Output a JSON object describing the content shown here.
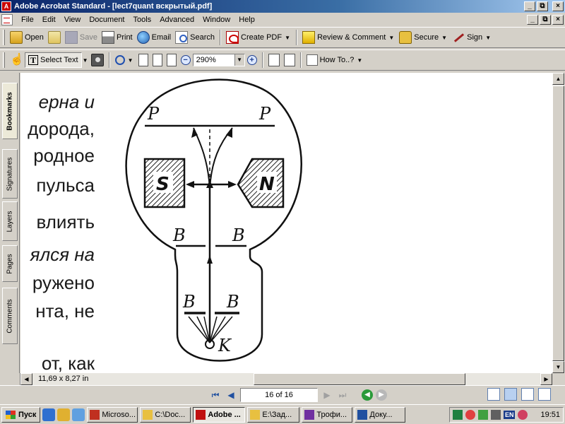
{
  "window": {
    "title": "Adobe Acrobat Standard - [lect7quant вскрытый.pdf]",
    "app_icon": "acrobat-icon",
    "buttons": [
      "_",
      "⧉",
      "×"
    ]
  },
  "menubar": {
    "items": [
      "File",
      "Edit",
      "View",
      "Document",
      "Tools",
      "Advanced",
      "Window",
      "Help"
    ],
    "doc_buttons": [
      "_",
      "⧉",
      "×"
    ]
  },
  "toolbar1": {
    "open": "Open",
    "save": "Save",
    "print": "Print",
    "email": "Email",
    "search": "Search",
    "create_pdf": "Create PDF",
    "review": "Review & Comment",
    "secure": "Secure",
    "sign": "Sign"
  },
  "toolbar2": {
    "hand_icon": "☝",
    "select_text": "Select Text",
    "zoom_value": "290%",
    "how_to": "How To..?"
  },
  "navtabs": [
    "Bookmarks",
    "Signatures",
    "Layers",
    "Pages",
    "Comments"
  ],
  "document": {
    "text_lines": [
      {
        "text": "ерна  и",
        "italic": true
      },
      {
        "text": "дорода,",
        "italic": false
      },
      {
        "text": "родное",
        "italic": false
      },
      {
        "text": "пульса",
        "italic": false
      },
      {
        "text": "влиять",
        "italic": false
      },
      {
        "text": "ялся на",
        "italic": true
      },
      {
        "text": "ружено",
        "italic": false
      },
      {
        "text": "нта,  не",
        "italic": false
      },
      {
        "text": "от,   как",
        "italic": false
      }
    ],
    "diagram_labels": {
      "p_left": "P",
      "p_right": "P",
      "s": "S",
      "n": "N",
      "b_mid_left": "B",
      "b_mid_right": "B",
      "b_low_left": "B",
      "b_low_right": "B",
      "k": "K"
    }
  },
  "status": {
    "page_size": "11,69 x 8,27 in",
    "page_field": "16 of 16"
  },
  "taskbar": {
    "start": "Пуск",
    "tasks": [
      {
        "label": "Microso...",
        "active": false,
        "color": "#c03020"
      },
      {
        "label": "C:\\Doc...",
        "active": false,
        "color": "#e8c040"
      },
      {
        "label": "Adobe ...",
        "active": true,
        "color": "#c01010"
      },
      {
        "label": "E:\\Зад...",
        "active": false,
        "color": "#e8c040"
      },
      {
        "label": "Трофи...",
        "active": false,
        "color": "#7030a0"
      },
      {
        "label": "Доку...",
        "active": false,
        "color": "#2050a0"
      }
    ],
    "lang": "EN",
    "clock": "19:51"
  }
}
